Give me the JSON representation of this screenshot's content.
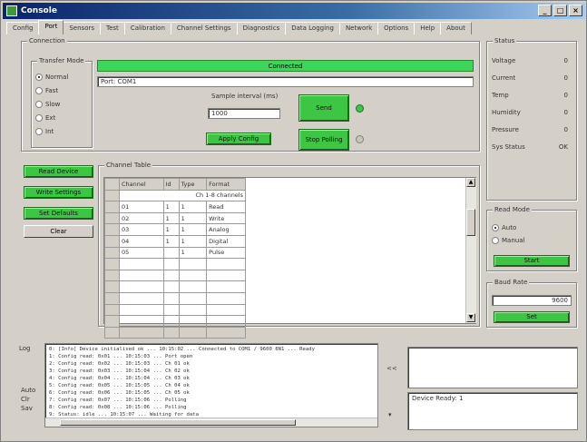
{
  "window": {
    "title": "Console",
    "controls": [
      "_",
      "□",
      "×"
    ]
  },
  "tabs": [
    "Config",
    "Port",
    "Sensors",
    "Test",
    "Calibration",
    "Channel Settings",
    "Diagnostics",
    "Data Logging",
    "Network",
    "Options",
    "Help",
    "About"
  ],
  "active_tab": 1,
  "left_group": {
    "title": "Connection",
    "mode_title": "Transfer Mode",
    "modes": [
      {
        "label": "Normal",
        "checked": true
      },
      {
        "label": "Fast",
        "checked": false
      },
      {
        "label": "Slow",
        "checked": false
      },
      {
        "label": "Ext",
        "checked": false
      },
      {
        "label": "Int",
        "checked": false
      }
    ],
    "status_banner": "Connected",
    "port_field": "Port: COM1",
    "interval_label": "Sample interval (ms)",
    "interval_value": "1000",
    "send_button": "Send",
    "apply_button": "Apply Config",
    "stop_button": "Stop Polling",
    "led_on_color": "#3cc644",
    "led_off_color": "#c8c8b0"
  },
  "status_group": {
    "title": "Status",
    "rows": [
      {
        "key": "Voltage",
        "value": "0"
      },
      {
        "key": "Current",
        "value": "0"
      },
      {
        "key": "Temp",
        "value": "0"
      },
      {
        "key": "Humidity",
        "value": "0"
      },
      {
        "key": "Pressure",
        "value": "0"
      },
      {
        "key": "Sys Status",
        "value": "OK"
      }
    ]
  },
  "actions": {
    "read_button": "Read Device",
    "write_button": "Write Settings",
    "defaults_button": "Set Defaults",
    "clear_button": "Clear"
  },
  "table_group": {
    "title": "Channel Table",
    "headers": [
      "",
      "Channel",
      "Id",
      "Type",
      "Format"
    ],
    "subheader": "Ch  1-8 channels",
    "rows": [
      [
        "",
        "01",
        "1",
        "1",
        "Read"
      ],
      [
        "",
        "02",
        "1",
        "1",
        "Write"
      ],
      [
        "",
        "03",
        "1",
        "1",
        "Analog"
      ],
      [
        "",
        "04",
        "1",
        "1",
        "Digital"
      ],
      [
        "",
        "05",
        "",
        "1",
        "Pulse"
      ],
      [
        "",
        "",
        "",
        "",
        ""
      ],
      [
        "",
        "",
        "",
        "",
        ""
      ],
      [
        "",
        "",
        "",
        "",
        ""
      ],
      [
        "",
        "",
        "",
        "",
        ""
      ],
      [
        "",
        "",
        "",
        "",
        ""
      ],
      [
        "",
        "",
        "",
        "",
        ""
      ],
      [
        "",
        "",
        "",
        "",
        ""
      ]
    ]
  },
  "mode_group": {
    "title": "Read Mode",
    "options": [
      {
        "label": "Auto",
        "checked": true
      },
      {
        "label": "Manual",
        "checked": false
      }
    ],
    "button": "Start"
  },
  "rate_group": {
    "title": "Baud Rate",
    "value": "9600",
    "button": "Set"
  },
  "log": {
    "label_left": "Log",
    "side_labels": [
      "Auto",
      "Clr",
      "Sav"
    ],
    "lines": [
      "0: [Info] Device initialised ok ... 10:15:02 ... Connected to COM1 / 9600 8N1 ... Ready",
      "1: Config read: 0x01 ... 10:15:03 ... Port open",
      "2: Config read: 0x02 ... 10:15:03 ... Ch 01 ok",
      "3: Config read: 0x03 ... 10:15:04 ... Ch 02 ok",
      "4: Config read: 0x04 ... 10:15:04 ... Ch 03 ok",
      "5: Config read: 0x05 ... 10:15:05 ... Ch 04 ok",
      "6: Config read: 0x06 ... 10:15:05 ... Ch 05 ok",
      "7: Config read: 0x07 ... 10:15:06 ... Polling",
      "8: Config read: 0x08 ... 10:15:06 ... Polling",
      "9: Status: idle ... 10:15:07 ... Waiting for data"
    ],
    "mid_button": "<<",
    "side_text": "Device Ready: 1"
  }
}
